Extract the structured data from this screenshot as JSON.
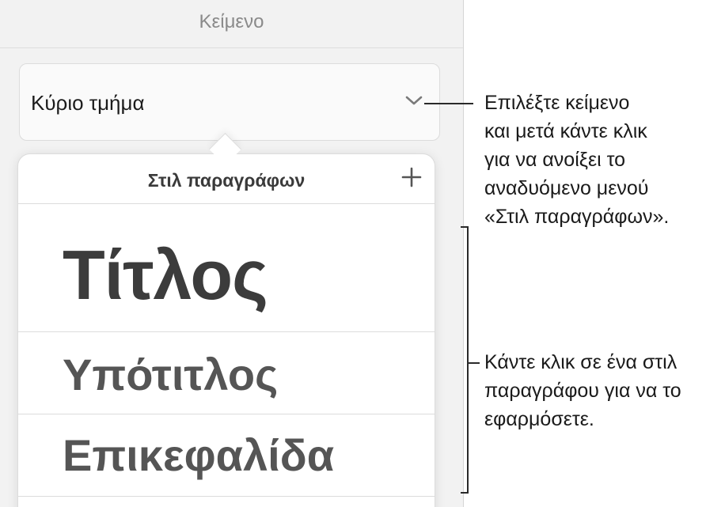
{
  "inspector": {
    "title": "Κείμενο",
    "style_select": {
      "value": "Κύριο τμήμα",
      "icon": "chevron-down-icon"
    }
  },
  "popover": {
    "title": "Στιλ παραγράφων",
    "add_icon": "plus-icon",
    "styles": [
      {
        "label": "Τίτλος"
      },
      {
        "label": "Υπότιτλος"
      },
      {
        "label": "Επικεφαλίδα"
      }
    ]
  },
  "callouts": [
    {
      "lines": [
        "Επιλέξτε κείμενο",
        "και μετά κάντε κλικ",
        "για να ανοίξει το",
        "αναδυόμενο μενού",
        "«Στιλ παραγράφων»."
      ]
    },
    {
      "lines": [
        "Κάντε κλικ σε ένα στιλ",
        "παραγράφου για να το",
        "εφαρμόσετε."
      ]
    }
  ],
  "colors": {
    "panel_background": "#f2f2f2",
    "popover_background": "#ffffff",
    "text": "#1c1c1c",
    "muted_text": "#8a8a8a"
  }
}
